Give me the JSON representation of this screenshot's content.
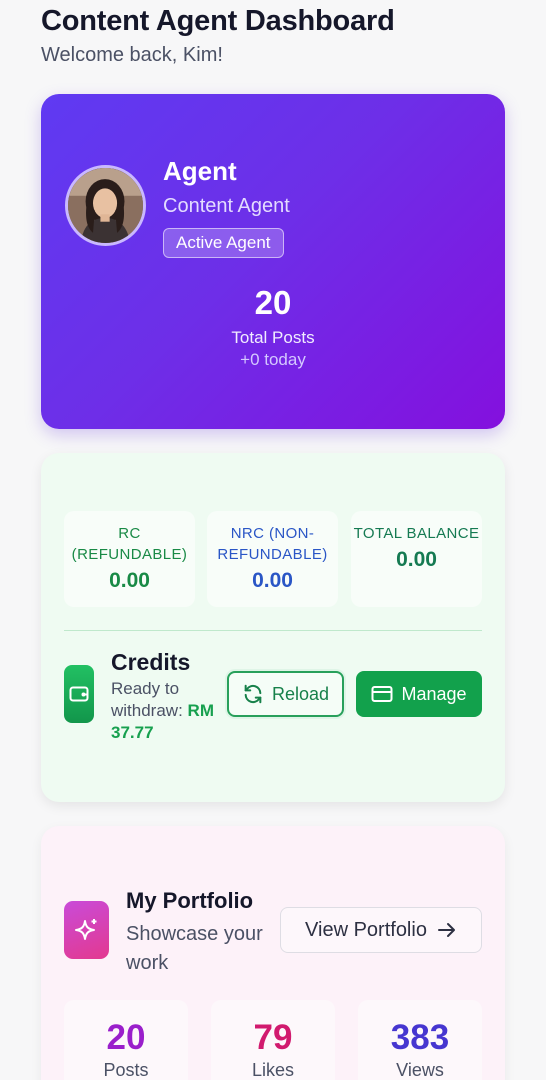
{
  "header": {
    "title": "Content Agent Dashboard",
    "welcome": "Welcome back, Kim!"
  },
  "agent": {
    "name": "Agent",
    "role": "Content Agent",
    "badge": "Active Agent",
    "total_posts": "20",
    "total_posts_label": "Total Posts",
    "today": "+0 today"
  },
  "credits": {
    "balances": [
      {
        "label": "RC (REFUNDABLE)",
        "value": "0.00",
        "color": "#198a46"
      },
      {
        "label": "NRC (NON-REFUNDABLE)",
        "value": "0.00",
        "color": "#2a56c6"
      },
      {
        "label": "TOTAL BALANCE",
        "value": "0.00",
        "color": "#157a52"
      }
    ],
    "title": "Credits",
    "withdraw_label": "Ready to withdraw:",
    "withdraw_amount": "RM 37.77",
    "reload_label": "Reload",
    "manage_label": "Manage",
    "icons": {
      "wallet": "wallet-icon",
      "reload": "refresh-icon",
      "manage": "credit-card-icon"
    }
  },
  "portfolio": {
    "title": "My Portfolio",
    "subtitle": "Showcase your work",
    "view_label": "View Portfolio",
    "stats": [
      {
        "value": "20",
        "label": "Posts",
        "color": "#9a1fcb"
      },
      {
        "value": "79",
        "label": "Likes",
        "color": "#d11a6e"
      },
      {
        "value": "383",
        "label": "Views",
        "color": "#4636d0"
      }
    ],
    "icons": {
      "sparkle": "sparkle-icon",
      "arrow": "arrow-right-icon"
    }
  },
  "colors": {
    "hero_gradient_start": "#5f3af2",
    "hero_gradient_end": "#8410de",
    "credits_bg": "#effbf2",
    "primary_green": "#12a14c",
    "portfolio_bg": "#fdf2f9"
  }
}
